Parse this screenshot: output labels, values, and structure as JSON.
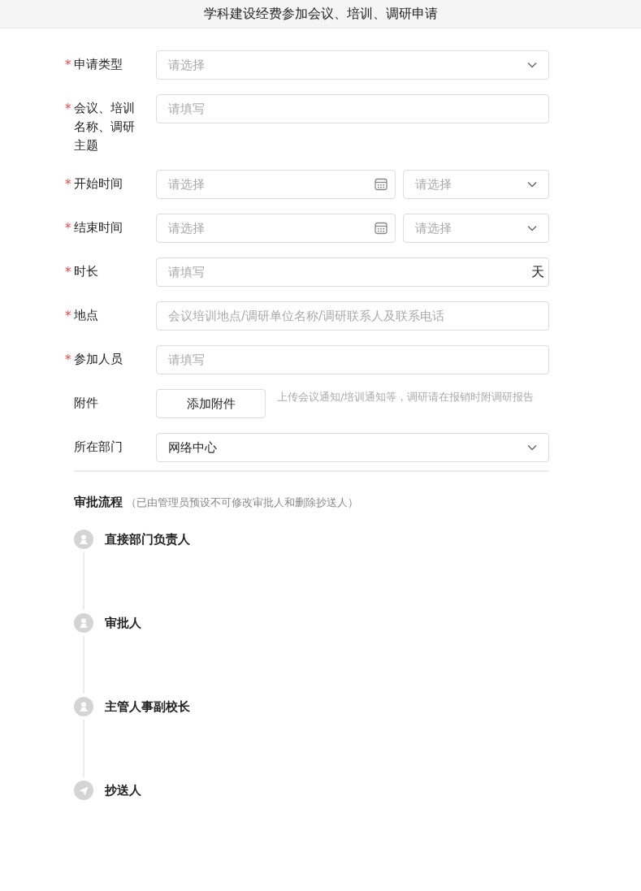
{
  "title": "学科建设经费参加会议、培训、调研申请",
  "fields": [
    {
      "kind": "select",
      "label": "申请类型",
      "required_mark": "*",
      "placeholder": "请选择"
    },
    {
      "kind": "text",
      "label": "会议、培训名称、调研主题",
      "required_mark": "*",
      "placeholder": "请填写"
    },
    {
      "kind": "datetime",
      "label": "开始时间",
      "required_mark": "*",
      "placeholder": "请选择",
      "time_placeholder": "请选择"
    },
    {
      "kind": "datetime",
      "label": "结束时间",
      "required_mark": "*",
      "placeholder": "请选择",
      "time_placeholder": "请选择"
    },
    {
      "kind": "suffix",
      "label": "时长",
      "required_mark": "*",
      "placeholder": "请填写",
      "suffix": "天"
    },
    {
      "kind": "text",
      "label": "地点",
      "required_mark": "*",
      "placeholder": "会议培训地点/调研单位名称/调研联系人及联系电话"
    },
    {
      "kind": "text",
      "label": "参加人员",
      "required_mark": "*",
      "placeholder": "请填写"
    },
    {
      "kind": "upload",
      "label": "附件",
      "button": "添加附件",
      "hint": "上传会议通知/培训通知等，调研请在报销时附调研报告"
    },
    {
      "kind": "select",
      "label": "所在部门",
      "value": "网络中心"
    }
  ],
  "approval": {
    "title": "审批流程",
    "note": "（已由管理员预设不可修改审批人和删除抄送人）",
    "steps": [
      {
        "kind": "person",
        "name": "直接部门负责人"
      },
      {
        "kind": "person",
        "name": "审批人"
      },
      {
        "kind": "person",
        "name": "主管人事副校长"
      },
      {
        "kind": "cc",
        "name": "抄送人"
      }
    ]
  }
}
